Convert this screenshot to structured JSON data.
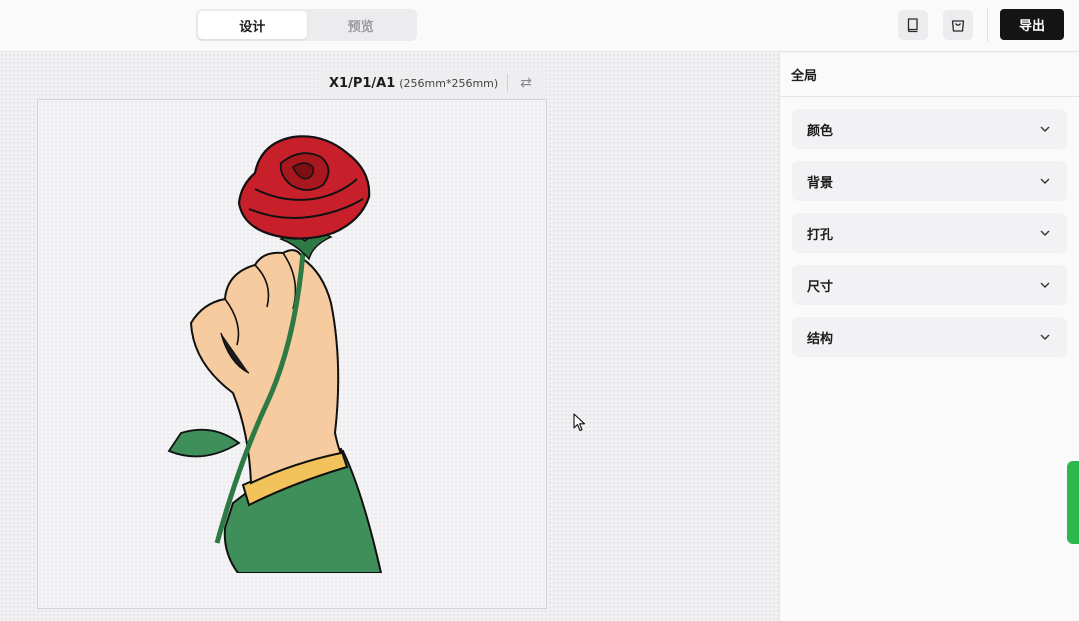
{
  "header": {
    "tabs": [
      {
        "label": "设计",
        "active": true
      },
      {
        "label": "预览",
        "active": false
      }
    ],
    "icons": [
      "book-icon",
      "shopping-bag-icon"
    ],
    "export_label": "导出",
    "export_color": "#141414"
  },
  "canvas": {
    "size_code": "X1/P1/A1",
    "size_dims": "(256mm*256mm)",
    "swap_icon": "swap-arrows-icon",
    "image_subject": "hand holding red rose"
  },
  "panel": {
    "title": "全局",
    "sections": [
      {
        "label": "颜色"
      },
      {
        "label": "背景"
      },
      {
        "label": "打孔"
      },
      {
        "label": "尺寸"
      },
      {
        "label": "结构"
      }
    ]
  },
  "colors": {
    "accent_green": "#2db84d",
    "rose_red": "#c8202a",
    "sleeve_green": "#3f8f5a",
    "skin": "#f7cba0"
  }
}
